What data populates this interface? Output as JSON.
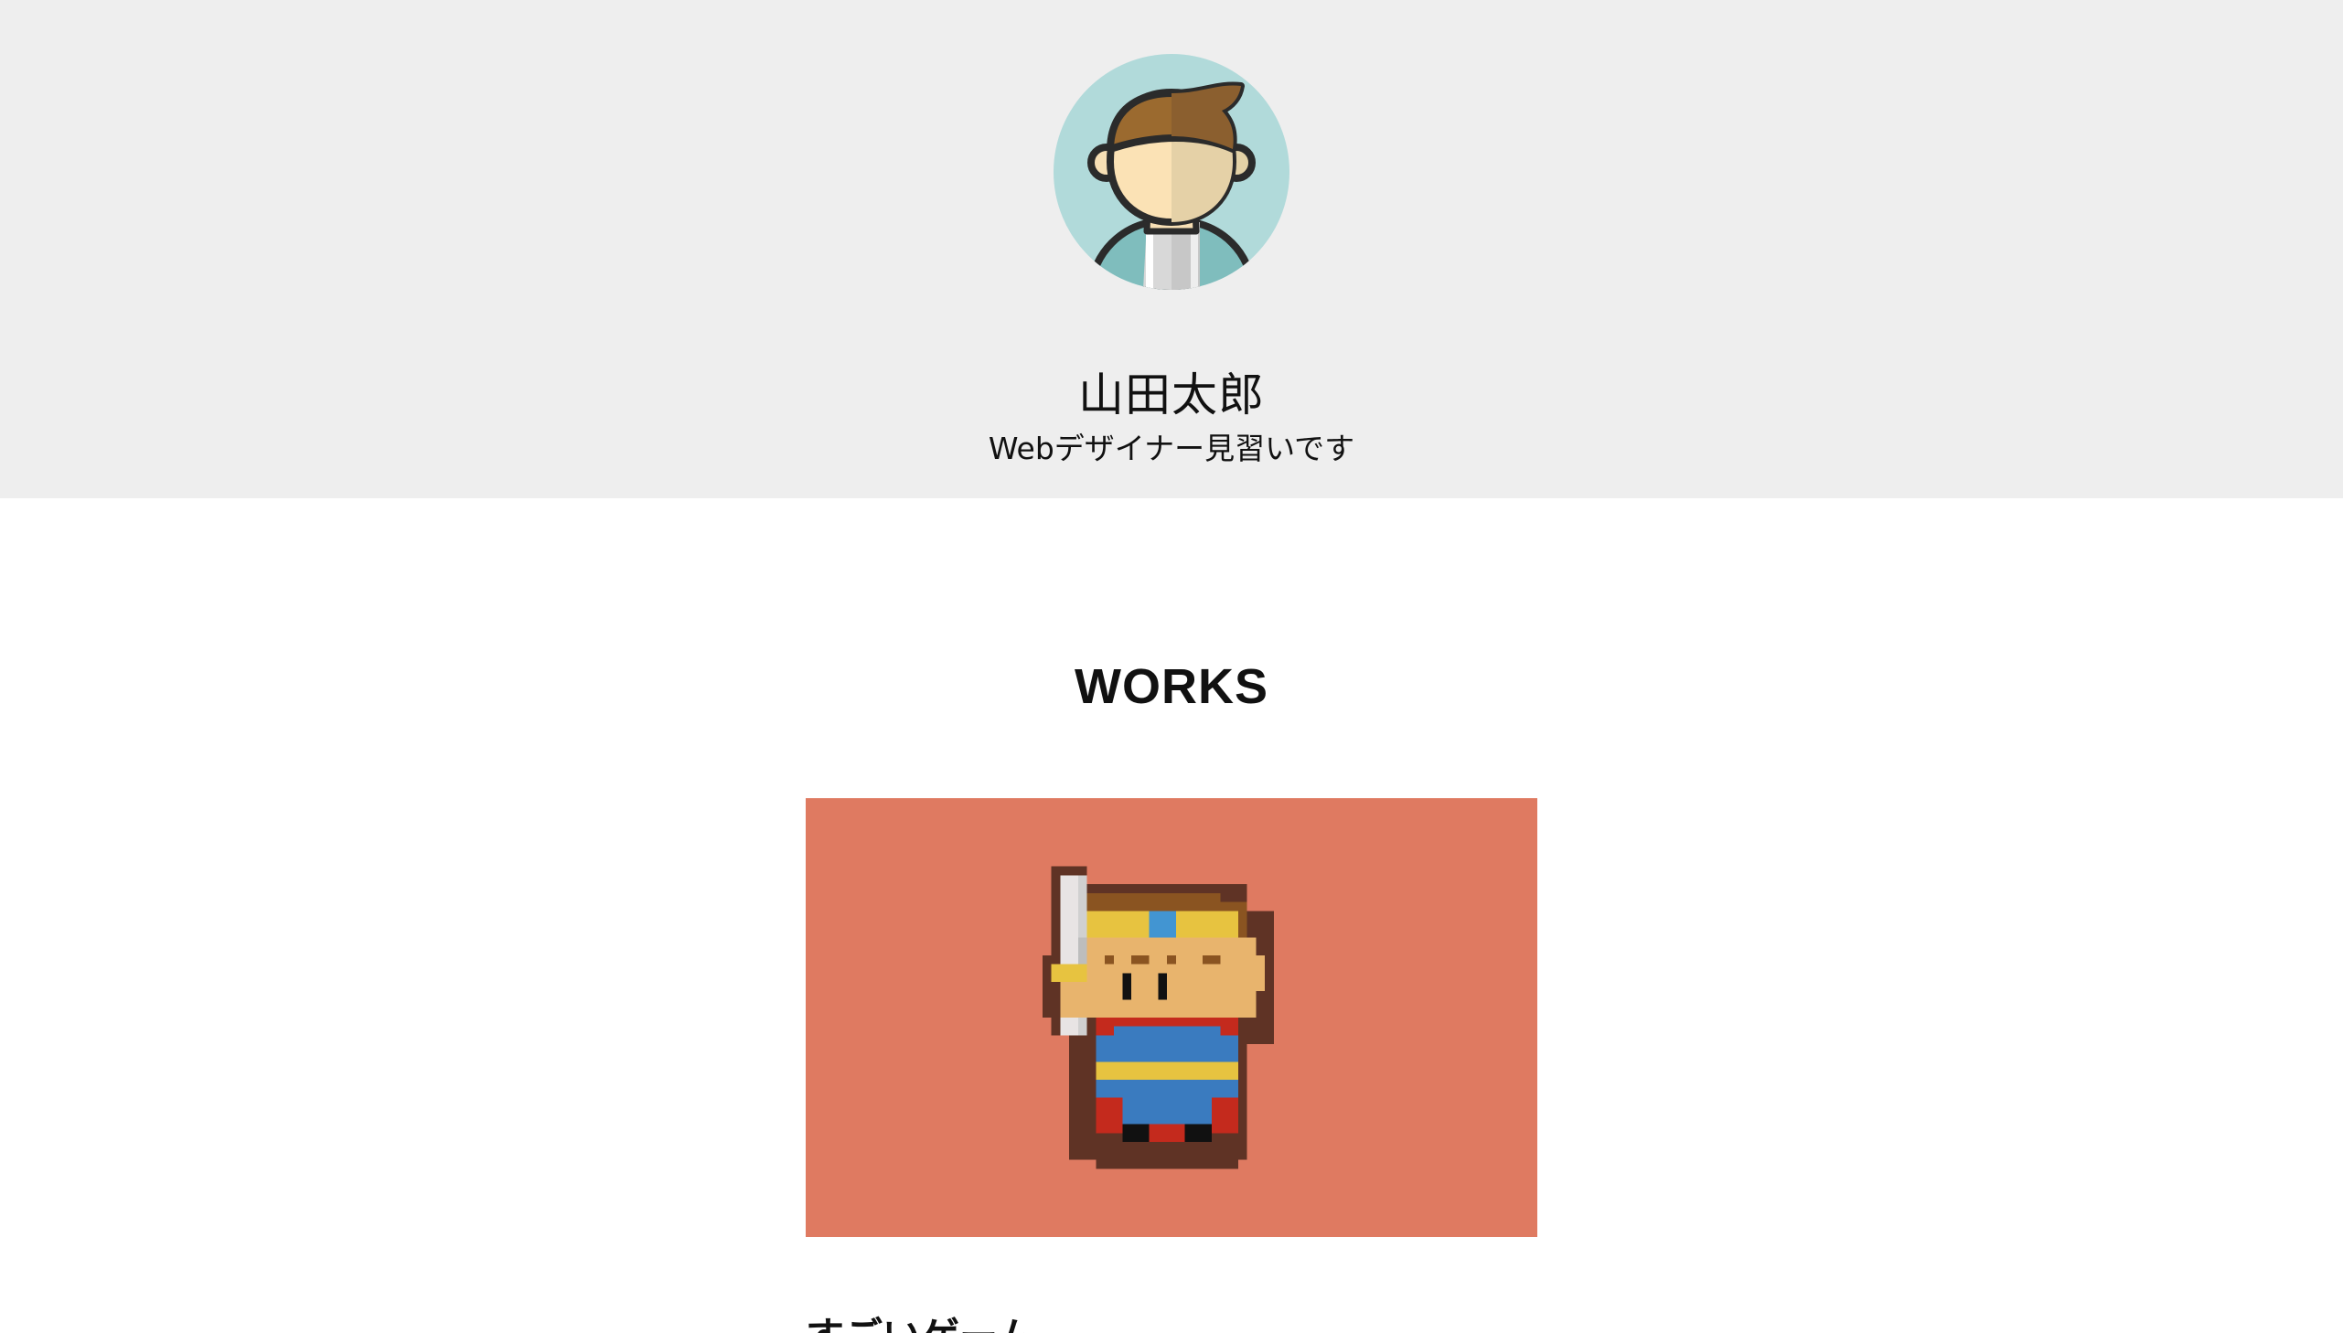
{
  "profile": {
    "name": "山田太郎",
    "role": "Webデザイナー見習いです",
    "avatar_icon": "person-avatar-icon",
    "avatar_background": "#b1dada"
  },
  "works": {
    "section_title": "WORKS",
    "items": [
      {
        "title": "すごいゲーム",
        "thumbnail_icon": "pixel-hero-icon",
        "thumbnail_background": "#df7a61"
      }
    ]
  },
  "colors": {
    "header_background": "#eeeeee",
    "page_background": "#ffffff",
    "text": "#111111"
  }
}
